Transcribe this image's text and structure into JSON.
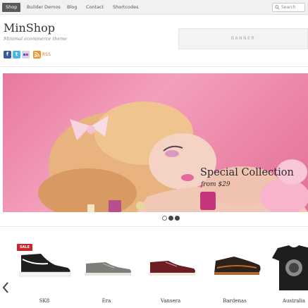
{
  "nav": {
    "items": [
      "Shop",
      "Builder Demos",
      "Blog",
      "Contact",
      "Shortcodes"
    ],
    "search_placeholder": "Search"
  },
  "header": {
    "logo": "MinShop",
    "tagline": "Minimal ecommerce theme",
    "banner": "BANNER",
    "rss_label": "RSS"
  },
  "slider": {
    "title": "Special Collection",
    "subtitle": "from $29",
    "slide_count": 3,
    "active_slide": 1
  },
  "products": [
    {
      "name": "SK8",
      "sale": "SALE"
    },
    {
      "name": "Era"
    },
    {
      "name": "Vansera"
    },
    {
      "name": "Bardenas"
    },
    {
      "name": "Australia"
    }
  ],
  "colors": {
    "accent": "#c8262a",
    "slider_bg": "#ec87a8",
    "facebook": "#3b5b98",
    "twitter": "#4fb3e8",
    "rss": "#f0922a"
  }
}
